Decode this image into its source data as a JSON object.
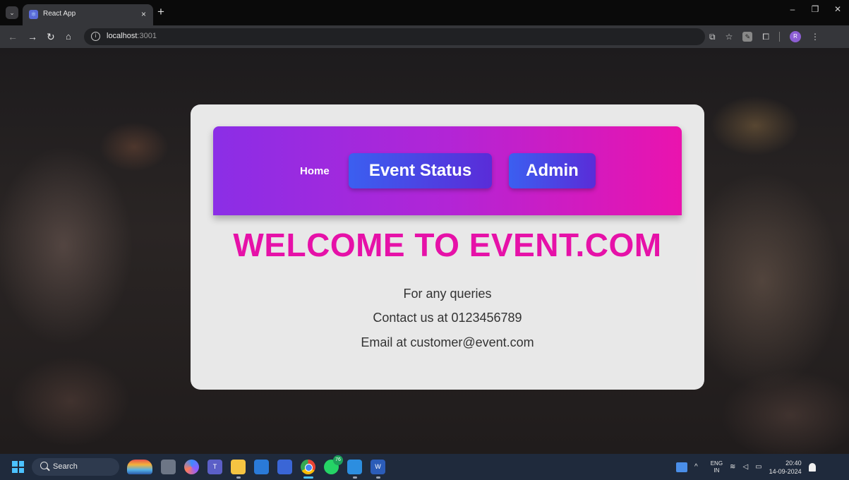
{
  "browser": {
    "tab_title": "React App",
    "close_tab": "×",
    "new_tab": "+",
    "url_host": "localhost",
    "url_port": ":3001",
    "window_controls": {
      "minimize": "–",
      "restore": "❐",
      "close": "✕"
    },
    "nav": {
      "back": "←",
      "forward": "→",
      "reload": "↻",
      "home": "⌂"
    },
    "profile_initial": "R"
  },
  "page": {
    "nav": {
      "home": "Home",
      "event_status": "Event Status",
      "admin": "Admin"
    },
    "heading": "WELCOME TO EVENT.COM",
    "contact": {
      "line1": "For any queries",
      "line2": "Contact us at 0123456789",
      "line3": "Email at customer@event.com"
    },
    "colors": {
      "heading": "#e611a8",
      "navbar_start": "#8b2ee6",
      "navbar_end": "#ea13ae",
      "pill_start": "#3b5ff0",
      "pill_end": "#5a2cd8"
    }
  },
  "taskbar": {
    "search_label": "Search",
    "whatsapp_badge": "76",
    "lang_top": "ENG",
    "lang_bottom": "IN",
    "time": "20:40",
    "date": "14-09-2024",
    "apps": [
      "widgets-icon",
      "task-view-icon",
      "copilot-icon",
      "teams-icon",
      "file-explorer-icon",
      "ms-store-icon",
      "photos-icon",
      "chrome-icon",
      "whatsapp-icon",
      "vscode-icon",
      "word-icon"
    ]
  }
}
